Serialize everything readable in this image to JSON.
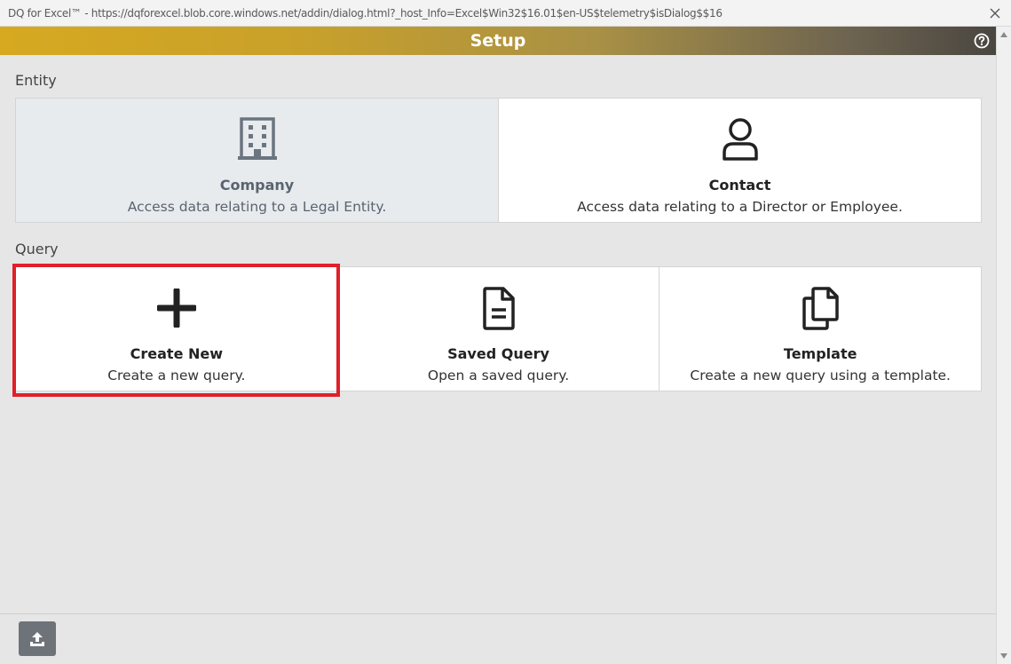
{
  "window": {
    "title": "DQ for Excel™ - https://dqforexcel.blob.core.windows.net/addin/dialog.html?_host_Info=Excel$Win32$16.01$en-US$telemetry$isDialog$$16",
    "close_icon": "close-icon"
  },
  "header": {
    "title": "Setup",
    "help_icon": "help-circle-icon",
    "gradient_colors": [
      "#d6a920",
      "#4a4640"
    ]
  },
  "entity": {
    "label": "Entity",
    "tiles": [
      {
        "name": "Company",
        "description": "Access data relating to a Legal Entity.",
        "icon": "building-icon",
        "state": "hover"
      },
      {
        "name": "Contact",
        "description": "Access data relating to a Director or Employee.",
        "icon": "person-icon"
      }
    ]
  },
  "query": {
    "label": "Query",
    "tiles": [
      {
        "name": "Create New",
        "description": "Create a new query.",
        "icon": "plus-icon",
        "highlighted": true
      },
      {
        "name": "Saved Query",
        "description": "Open a saved query.",
        "icon": "document-icon"
      },
      {
        "name": "Template",
        "description": "Create a new query using a template.",
        "icon": "copy-icon"
      }
    ]
  },
  "footer": {
    "upload_icon": "upload-icon"
  },
  "colors": {
    "highlight": "#e0202a",
    "button": "#6e7379"
  }
}
